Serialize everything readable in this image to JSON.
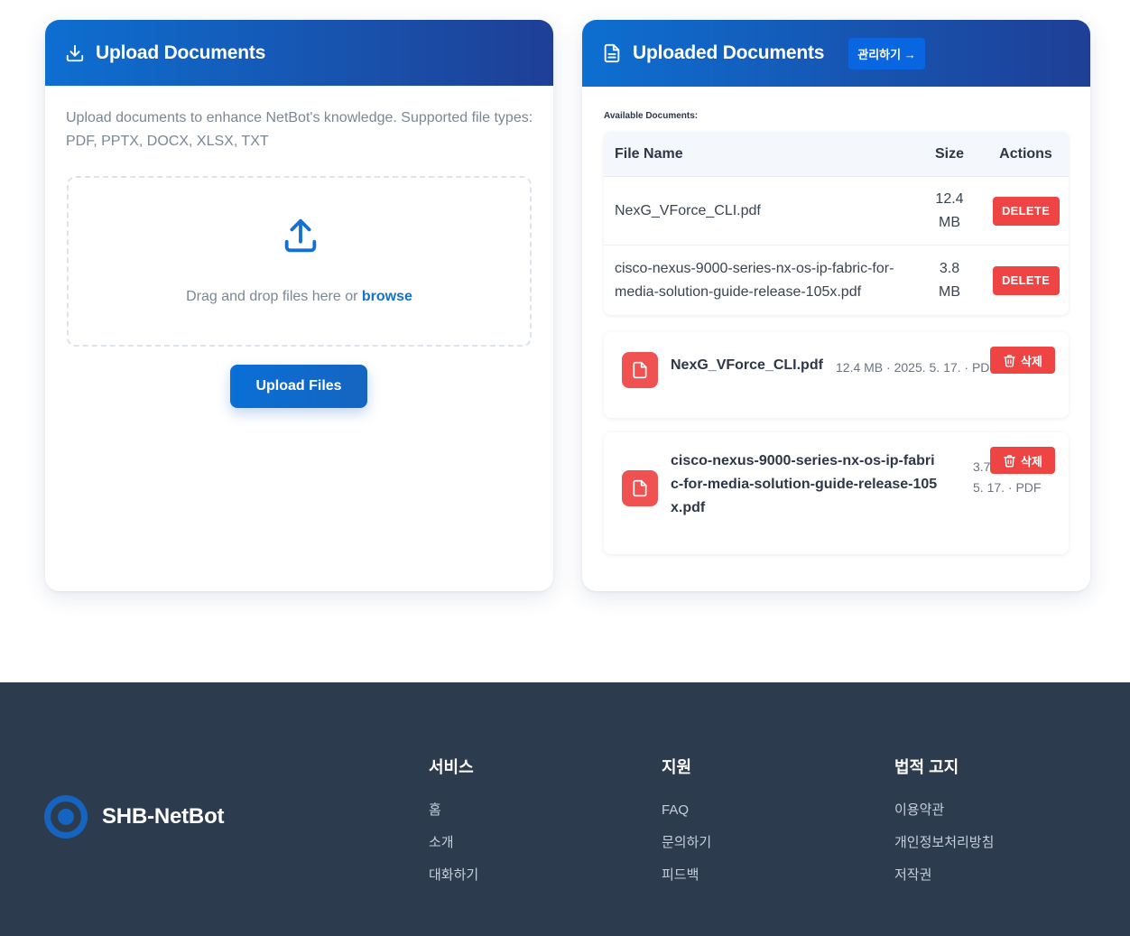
{
  "upload_card": {
    "title": "Upload Documents",
    "description": "Upload documents to enhance NetBot's knowledge. Supported file types: PDF, PPTX, DOCX, XLSX, TXT",
    "drop_text": "Drag and drop files here or ",
    "browse_label": "browse",
    "upload_button": "Upload Files"
  },
  "uploaded_card": {
    "title": "Uploaded Documents",
    "manage_button": "관리하기 →",
    "available_label": "Available Documents:",
    "table": {
      "headers": {
        "name": "File Name",
        "size": "Size",
        "actions": "Actions"
      },
      "rows": [
        {
          "name": "NexG_VForce_CLI.pdf",
          "size": "12.4 MB",
          "action": "DELETE"
        },
        {
          "name": "cisco-nexus-9000-series-nx-os-ip-fabric-for-media-solution-guide-release-105x.pdf",
          "size": "3.8 MB",
          "action": "DELETE"
        }
      ]
    },
    "doc_cards": [
      {
        "name": "NexG_VForce_CLI.pdf",
        "meta": "12.4 MB · 2025. 5. 17. · PDF",
        "delete_label": "삭제"
      },
      {
        "name": "cisco-nexus-9000-series-nx-os-ip-fabric-for-media-solution-guide-release-105x.pdf",
        "meta": "3.7 MB · 2025. 5. 17. · PDF",
        "delete_label": "삭제"
      }
    ]
  },
  "footer": {
    "brand": "SHB-NetBot",
    "columns": [
      {
        "title": "서비스",
        "links": [
          "홈",
          "소개",
          "대화하기"
        ]
      },
      {
        "title": "지원",
        "links": [
          "FAQ",
          "문의하기",
          "피드백"
        ]
      },
      {
        "title": "법적 고지",
        "links": [
          "이용약관",
          "개인정보처리방침",
          "저작권"
        ]
      }
    ]
  },
  "colors": {
    "header_gradient_start": "#0d6fd1",
    "header_gradient_end": "#1f3f96",
    "accent": "#1570d4",
    "danger": "#ef4444",
    "footer_bg": "#2d3b4e"
  },
  "icons": {
    "upload_header": "download-tray-icon",
    "uploaded_header": "document-icon",
    "dropzone": "upload-icon",
    "file": "file-icon",
    "trash": "trash-icon"
  }
}
